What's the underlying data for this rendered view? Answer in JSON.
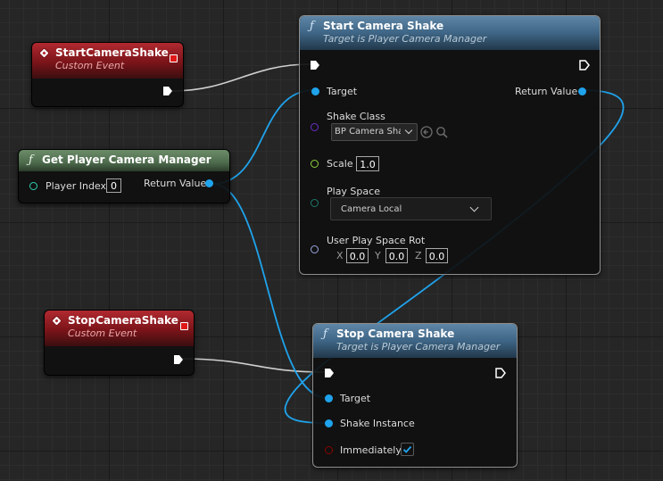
{
  "nodes": {
    "start_event": {
      "title": "StartCameraShake",
      "subtitle": "Custom Event"
    },
    "stop_event": {
      "title": "StopCameraShake",
      "subtitle": "Custom Event"
    },
    "get_manager": {
      "title": "Get Player Camera Manager",
      "player_index_label": "Player Index",
      "player_index_value": "0",
      "return_label": "Return Value"
    },
    "start_shake": {
      "title": "Start Camera Shake",
      "subtitle": "Target is Player Camera Manager",
      "target_label": "Target",
      "return_label": "Return Value",
      "shake_class_label": "Shake Class",
      "shake_class_value": "BP Camera Shal",
      "scale_label": "Scale",
      "scale_value": "1.0",
      "play_space_label": "Play Space",
      "play_space_value": "Camera Local",
      "rot_label": "User Play Space Rot",
      "rot": {
        "x_label": "X",
        "x": "0.0",
        "y_label": "Y",
        "y": "0.0",
        "z_label": "Z",
        "z": "0.0"
      }
    },
    "stop_shake": {
      "title": "Stop Camera Shake",
      "subtitle": "Target is Player Camera Manager",
      "target_label": "Target",
      "instance_label": "Shake Instance",
      "immediately_label": "Immediately",
      "immediately_checked": true
    }
  },
  "colors": {
    "object_pin": "#1fa3ec",
    "class_pin": "#6a2ec8",
    "int_pin": "#2fd0b0",
    "float_pin": "#8cd23c",
    "enum_pin": "#1c7a6b",
    "rotator_pin": "#9aa6e0",
    "bool_pin": "#8a0000",
    "event_header": "#b02a30",
    "function_header": "#3e6585",
    "pure_header": "#4d6b4c"
  },
  "icons": [
    "event-diamond-icon",
    "function-f-icon",
    "exec-pin-icon",
    "chevron-down-icon",
    "browse-arrow-icon",
    "search-icon",
    "check-icon",
    "delegate-pin-icon"
  ]
}
